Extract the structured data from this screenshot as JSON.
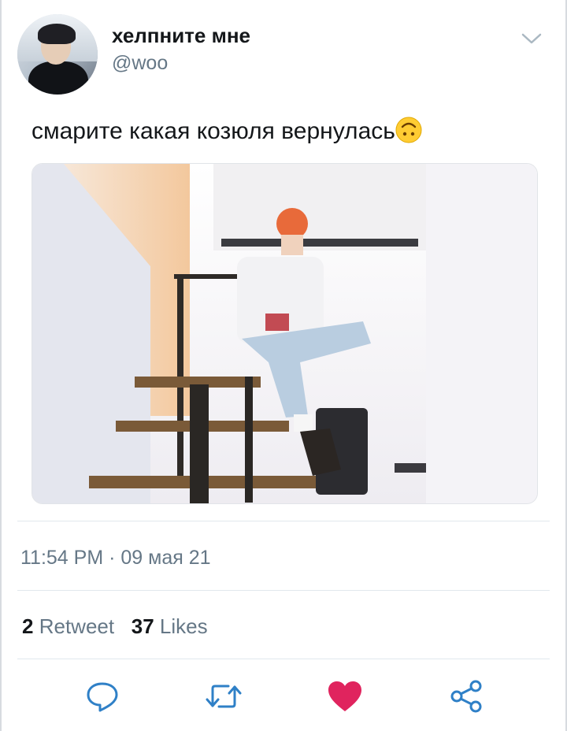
{
  "author": {
    "name": "хелпните мне",
    "handle": "@woo"
  },
  "tweet": {
    "text": "смарите какая козюля вернулась",
    "emoji": "upside-down-face-emoji"
  },
  "meta": {
    "time": "11:54 PM",
    "separator": "·",
    "date": "09 мая 21"
  },
  "stats": {
    "retweets": "2",
    "retweets_label": "Retweet",
    "likes": "37",
    "likes_label": "Likes"
  },
  "actions": [
    {
      "icon": "reply-icon"
    },
    {
      "icon": "retweet-icon"
    },
    {
      "icon": "like-heart-icon"
    },
    {
      "icon": "share-icon"
    }
  ],
  "colors": {
    "text_primary": "#14171a",
    "text_secondary": "#657786",
    "icon": "#2f80c7",
    "like": "#e0245e",
    "divider": "#e1e8ed"
  }
}
